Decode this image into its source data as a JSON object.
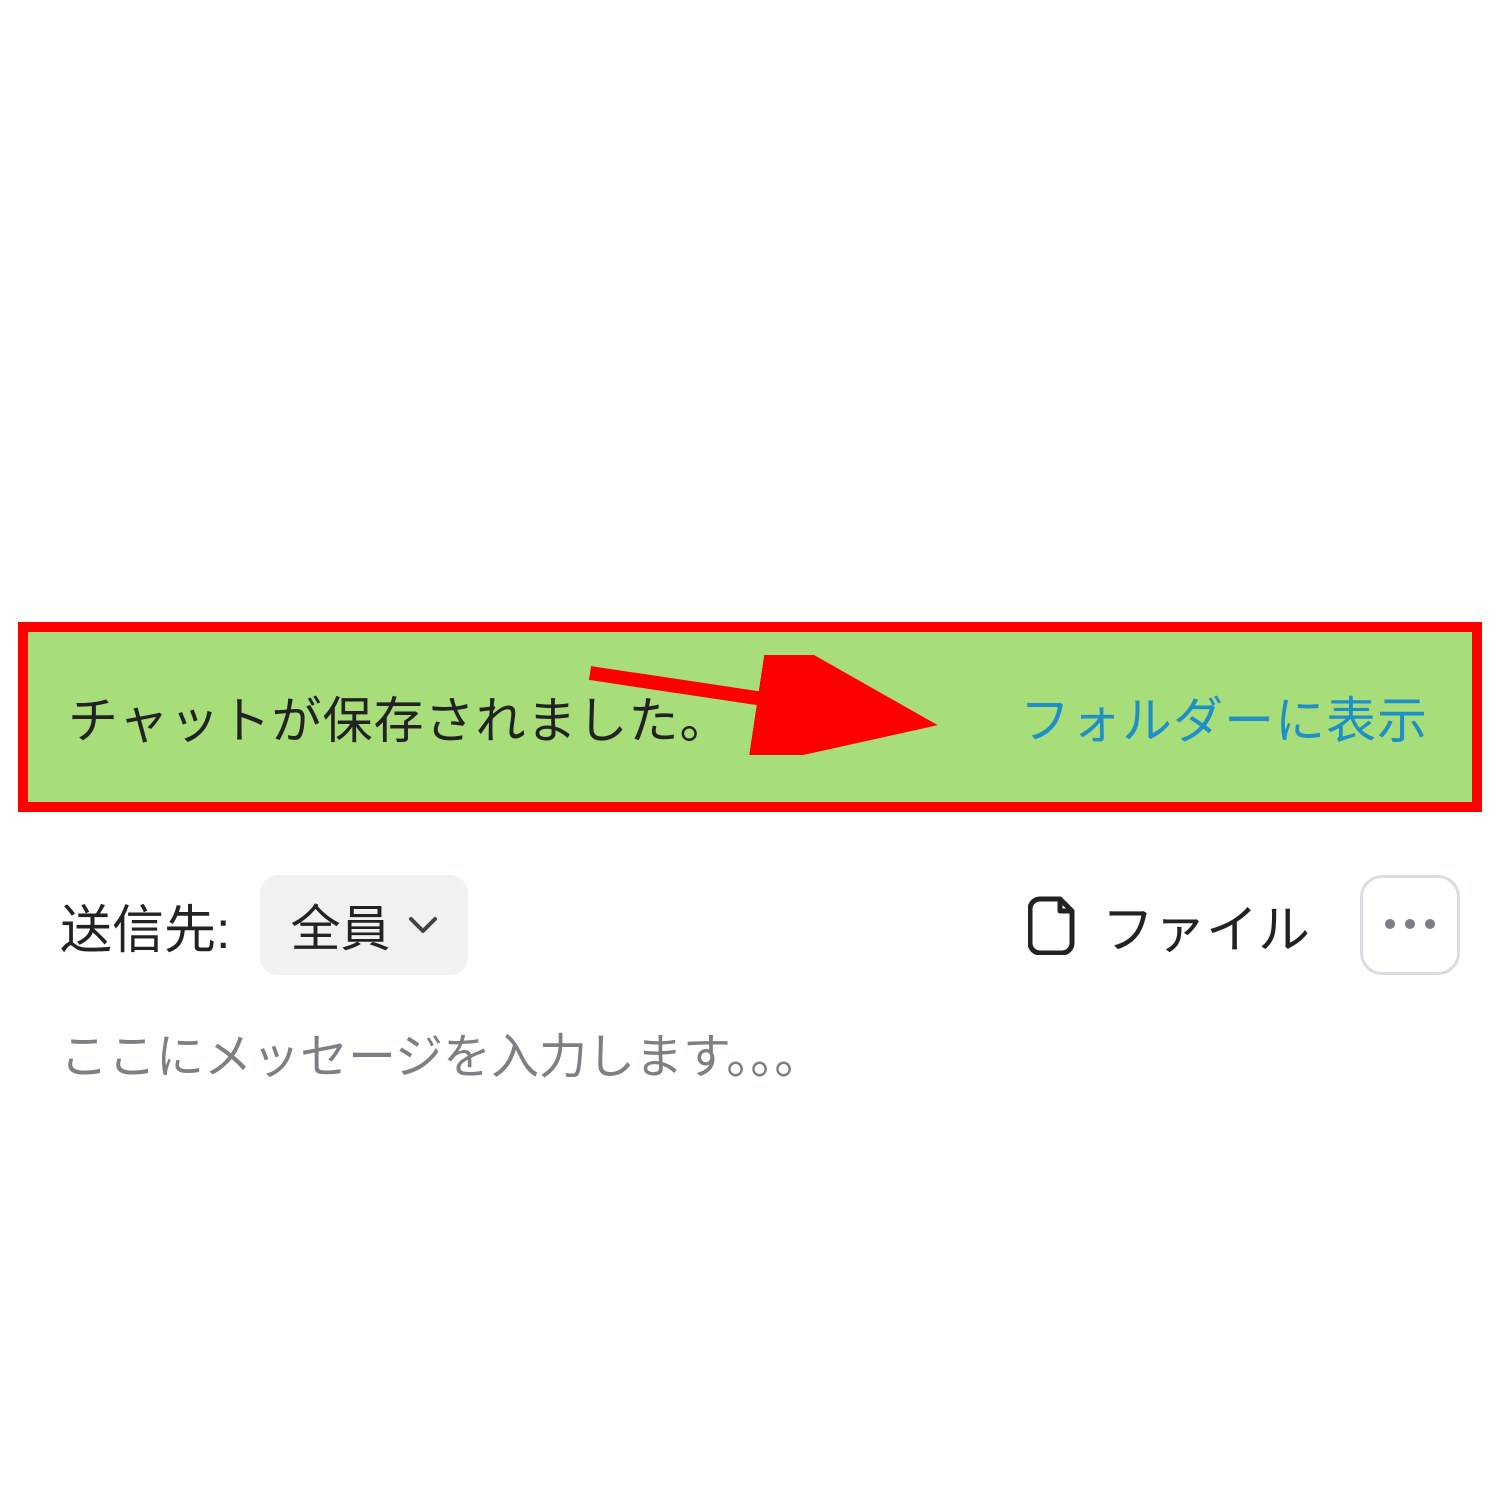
{
  "banner": {
    "message": "チャットが保存されました。",
    "link_label": "フォルダーに表示"
  },
  "compose": {
    "recipient_label": "送信先:",
    "recipient_value": "全員",
    "file_label": "ファイル",
    "input_placeholder": "ここにメッセージを入力します。。。"
  },
  "icons": {
    "chevron_down": "chevron-down-icon",
    "file": "file-icon",
    "more": "more-icon"
  },
  "colors": {
    "banner_bg": "#a8de79",
    "highlight_border": "#ff0000",
    "link": "#1f8fc8",
    "arrow": "#ff0000"
  }
}
